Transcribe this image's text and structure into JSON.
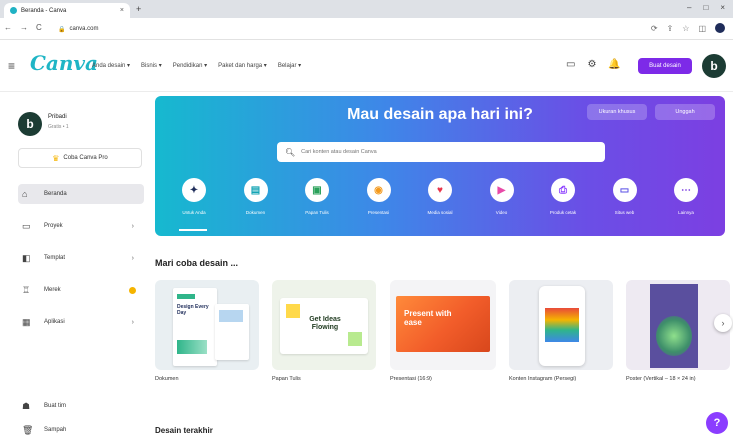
{
  "browser": {
    "tab_title": "Beranda - Canva",
    "tab_close": "×",
    "new_tab": "+",
    "window_controls": [
      "–",
      "□",
      "×"
    ],
    "nav": [
      "←",
      "→",
      "C"
    ],
    "url": "canva.com",
    "lock": "🔒"
  },
  "header": {
    "logo": "Canva",
    "nav": [
      "Anda desain ▾",
      "Bisnis ▾",
      "Pendidikan ▾",
      "Paket dan harga ▾",
      "Belajar ▾"
    ],
    "create_button": "Buat desain",
    "avatar_letter": "b"
  },
  "sidebar": {
    "avatar_letter": "b",
    "user_name": "Pribadi",
    "user_sub": "Gratis • 1",
    "pro_button": "Coba Canva Pro",
    "items": [
      {
        "label": "Beranda",
        "icon": "home-icon",
        "glyph": "⌂",
        "active": true,
        "arrow": ""
      },
      {
        "label": "Proyek",
        "icon": "folder-icon",
        "glyph": "▭",
        "active": false,
        "arrow": "›"
      },
      {
        "label": "Templat",
        "icon": "template-icon",
        "glyph": "◧",
        "active": false,
        "arrow": "›"
      },
      {
        "label": "Merek",
        "icon": "brand-icon",
        "glyph": "♖",
        "active": false,
        "arrow": "",
        "badge": true
      },
      {
        "label": "Aplikasi",
        "icon": "apps-icon",
        "glyph": "▦",
        "active": false,
        "arrow": "›"
      }
    ],
    "bottom_items": [
      {
        "label": "Buat tim",
        "icon": "team-icon",
        "glyph": "☗"
      },
      {
        "label": "Sampah",
        "icon": "trash-icon",
        "glyph": "🗑"
      }
    ]
  },
  "banner": {
    "title": "Mau desain apa hari ini?",
    "custom_size_button": "Ukuran khusus",
    "upload_button": "Unggah",
    "search_placeholder": "Cari konten atau desain Canva",
    "categories": [
      {
        "label": "Untuk Anda",
        "icon": "sparkle-icon",
        "glyph": "✦",
        "color": "#1f2d5a"
      },
      {
        "label": "Dokumen",
        "icon": "document-icon",
        "glyph": "▤",
        "color": "#13a4b4"
      },
      {
        "label": "Papan Tulis",
        "icon": "whiteboard-icon",
        "glyph": "▣",
        "color": "#2aa15a"
      },
      {
        "label": "Presentasi",
        "icon": "presentation-icon",
        "glyph": "◉",
        "color": "#f39a1e"
      },
      {
        "label": "Media sosial",
        "icon": "social-media-icon",
        "glyph": "♥",
        "color": "#e8334a"
      },
      {
        "label": "Video",
        "icon": "video-icon",
        "glyph": "▶",
        "color": "#e84aa8"
      },
      {
        "label": "Produk cetak",
        "icon": "print-icon",
        "glyph": "⎙",
        "color": "#8b3dff"
      },
      {
        "label": "Situs web",
        "icon": "website-icon",
        "glyph": "▭",
        "color": "#5a4fe6"
      },
      {
        "label": "Lainnya",
        "icon": "more-icon",
        "glyph": "⋯",
        "color": "#7c3fe2"
      }
    ]
  },
  "try_design": {
    "title": "Mari coba desain ...",
    "items": [
      {
        "label": "Dokumen",
        "thumb_text": "Design Every Day"
      },
      {
        "label": "Papan Tulis",
        "thumb_text": "Get Ideas Flowing"
      },
      {
        "label": "Presentasi (16:9)",
        "thumb_text": "Present with ease"
      },
      {
        "label": "Konten Instagram (Persegi)",
        "thumb_text": ""
      },
      {
        "label": "Poster (Vertikal – 18 × 24 in)",
        "thumb_text": ""
      }
    ],
    "next_arrow": "›"
  },
  "recent": {
    "title": "Desain terakhir"
  },
  "help": {
    "label": "?"
  },
  "colors": {
    "brand_teal": "#1fb5c5",
    "brand_purple": "#7d2ae8",
    "avatar": "#1c3c34"
  }
}
